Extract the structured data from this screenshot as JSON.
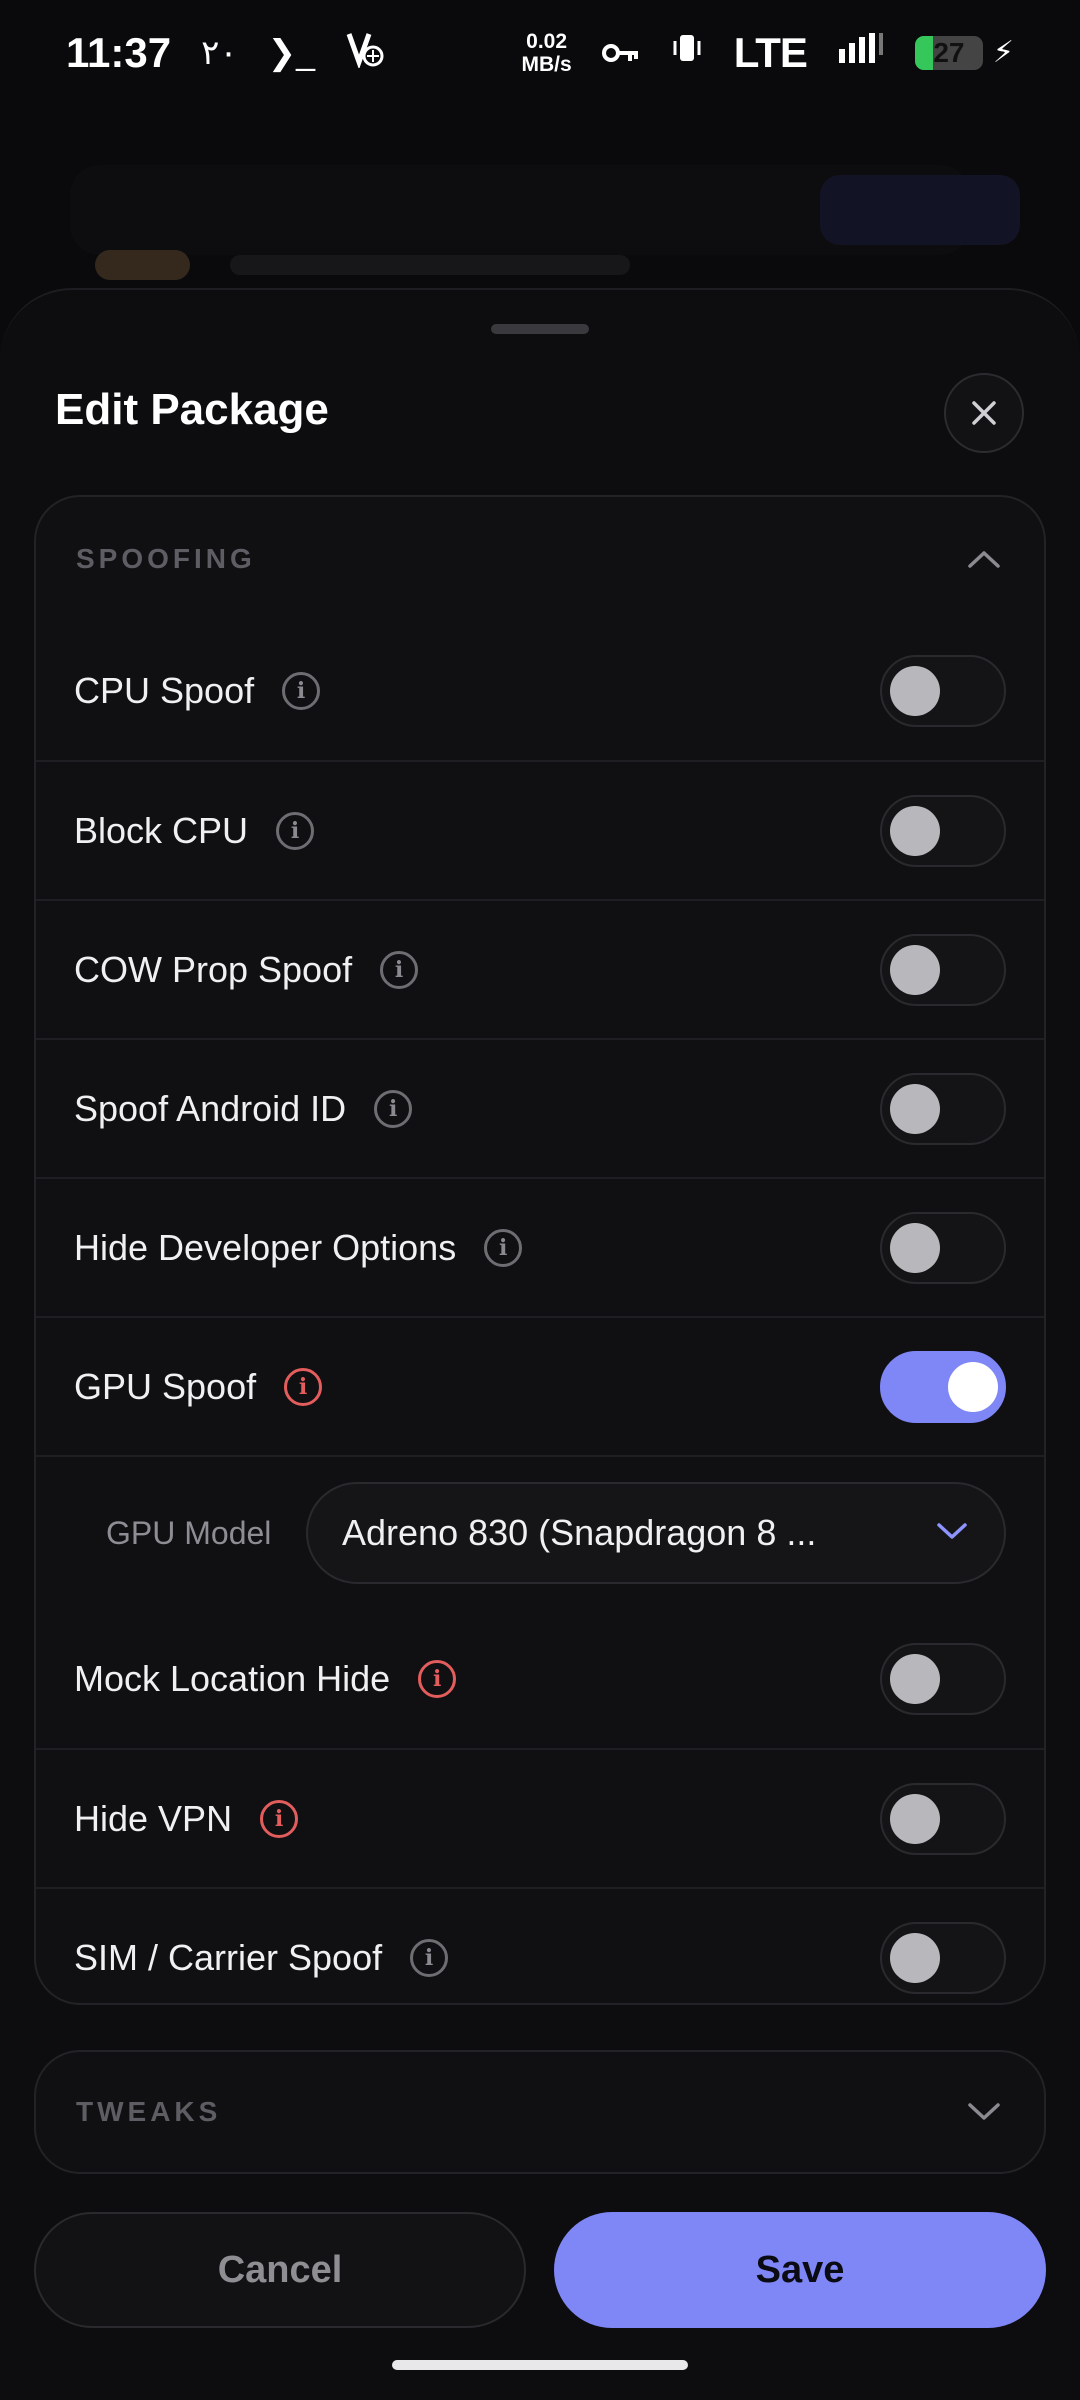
{
  "status_bar": {
    "time": "11:37",
    "extra_left": "٢٠",
    "terminal_glyph": "❯_",
    "net_speed_value": "0.02",
    "net_speed_unit": "MB/s",
    "network": "LTE",
    "battery_level": "27",
    "battery_percent": 27
  },
  "sheet": {
    "title": "Edit Package",
    "close_icon": "close-icon"
  },
  "spoofing": {
    "title": "SPOOFING",
    "expanded": true,
    "rows": [
      {
        "label": "CPU Spoof",
        "info": "neutral",
        "on": false
      },
      {
        "label": "Block CPU",
        "info": "neutral",
        "on": false
      },
      {
        "label": "COW Prop Spoof",
        "info": "neutral",
        "on": false
      },
      {
        "label": "Spoof Android ID",
        "info": "neutral",
        "on": false
      },
      {
        "label": "Hide Developer Options",
        "info": "neutral",
        "on": false
      },
      {
        "label": "GPU Spoof",
        "info": "warning",
        "on": true
      }
    ],
    "gpu_model": {
      "label": "GPU Model",
      "value": "Adreno 830 (Snapdragon 8 ..."
    },
    "rows_after": [
      {
        "label": "Mock Location Hide",
        "info": "warning",
        "on": false
      },
      {
        "label": "Hide VPN",
        "info": "warning",
        "on": false
      },
      {
        "label": "SIM / Carrier Spoof",
        "info": "neutral",
        "on": false
      }
    ]
  },
  "tweaks": {
    "title": "TWEAKS",
    "expanded": false
  },
  "footer": {
    "cancel_label": "Cancel",
    "save_label": "Save"
  },
  "colors": {
    "accent": "#7f86f5",
    "warning": "#e35d5d",
    "background": "#0d0d0f"
  }
}
